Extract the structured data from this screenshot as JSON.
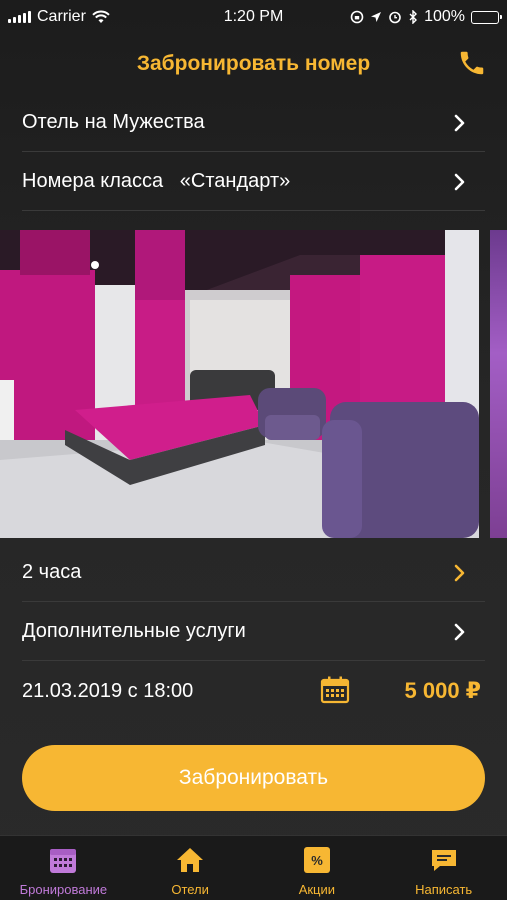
{
  "status_bar": {
    "carrier": "Carrier",
    "time": "1:20 PM",
    "battery": "100%"
  },
  "header": {
    "title": "Забронировать номер",
    "phone_icon": "phone-icon"
  },
  "rows": {
    "hotel": "Отель на Мужества",
    "room_class": "Номера класса   «Стандарт»",
    "duration": "2 часа",
    "extras": "Дополнительные услуги",
    "datetime": "21.03.2019 с 18:00",
    "price": "5 000 ₽"
  },
  "book_button": {
    "label": "Забронировать"
  },
  "tabs": [
    {
      "label": "Бронирование",
      "icon": "calendar-icon",
      "active": true
    },
    {
      "label": "Отели",
      "icon": "home-icon",
      "active": false
    },
    {
      "label": "Акции",
      "icon": "percent-icon",
      "active": false
    },
    {
      "label": "Написать",
      "icon": "chat-icon",
      "active": false
    }
  ],
  "colors": {
    "accent": "#f7b733",
    "active_tab": "#c07ad9",
    "background": "#262626"
  }
}
